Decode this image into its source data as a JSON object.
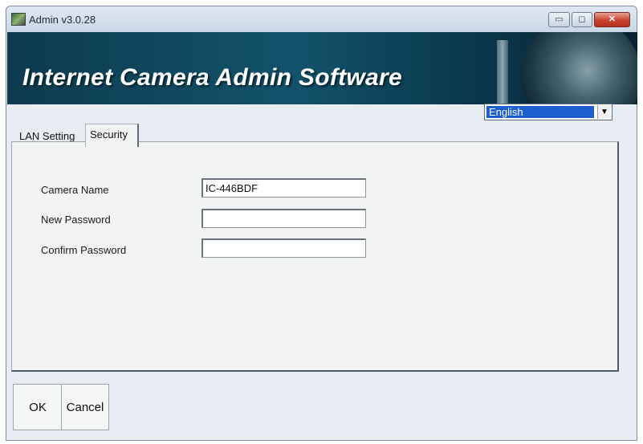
{
  "window": {
    "title": "Admin v3.0.28",
    "controls": {
      "minimize": "▭",
      "maximize": "◻",
      "close": "✕"
    }
  },
  "banner": {
    "title": "Internet Camera Admin Software"
  },
  "language": {
    "selected": "English",
    "arrow": "▼"
  },
  "tabs": [
    {
      "label": "LAN Setting",
      "active": false
    },
    {
      "label": "Security",
      "active": true
    }
  ],
  "form": {
    "camera_name": {
      "label": "Camera Name",
      "value": "IC-446BDF"
    },
    "new_password": {
      "label": "New Password",
      "value": ""
    },
    "confirm_password": {
      "label": "Confirm Password",
      "value": ""
    }
  },
  "buttons": {
    "ok": "OK",
    "cancel": "Cancel"
  },
  "colors": {
    "banner": "#12536b",
    "selection": "#1d5fcf",
    "close_button": "#c8402e"
  }
}
